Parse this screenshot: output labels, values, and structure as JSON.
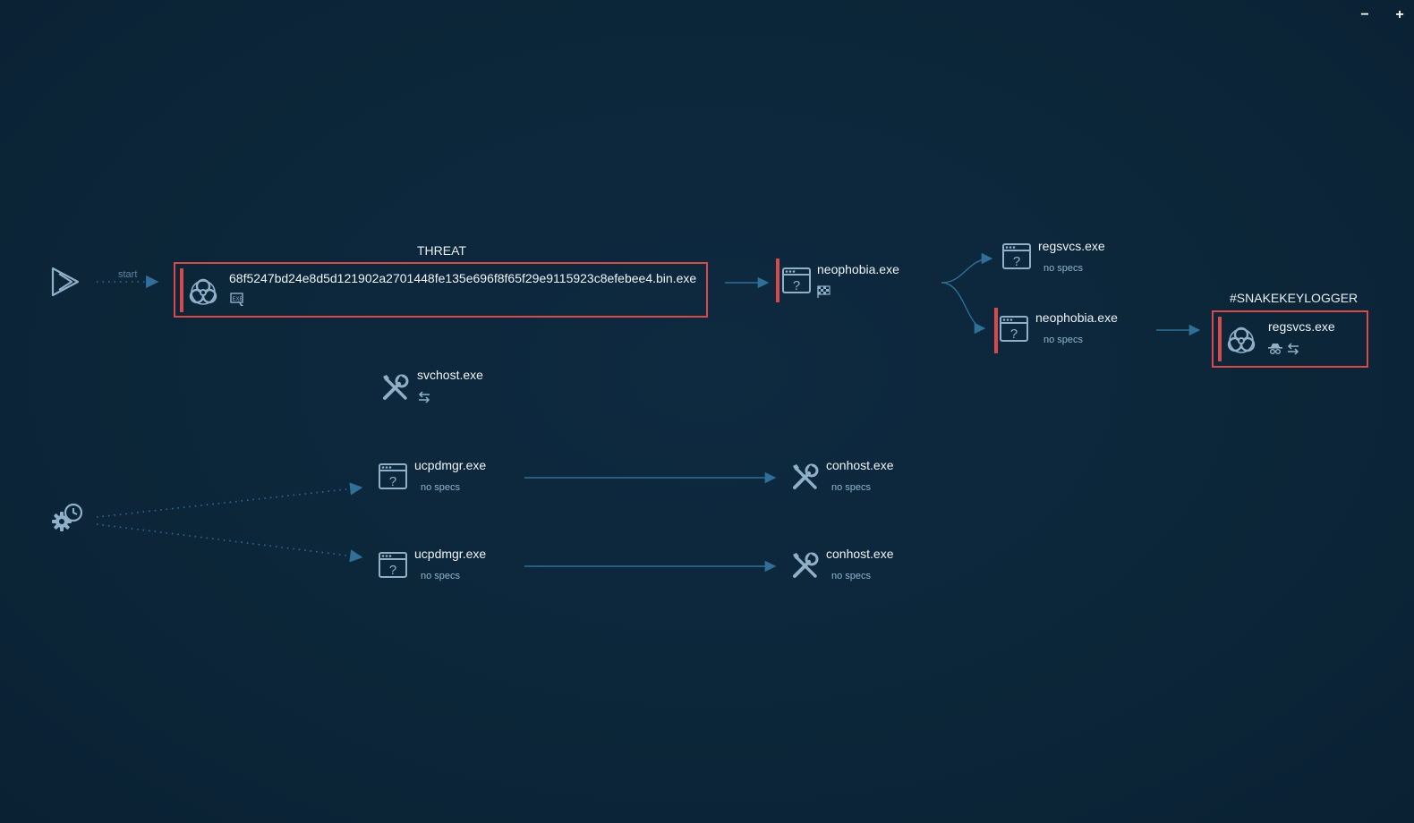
{
  "controls": {
    "zoom_out_label": "−",
    "zoom_in_label": "+"
  },
  "edges": {
    "start_label": "start"
  },
  "groups": {
    "threat": "THREAT",
    "snakekeylogger": "#SNAKEKEYLOGGER"
  },
  "nodes": {
    "main_threat": {
      "name": "68f5247bd24e8d5d121902a2701448fe135e696f8f65f29e9115923c8efebee4.bin.exe",
      "icon": "biohazard-icon",
      "badges": [
        "exe-icon"
      ]
    },
    "neophobia_1": {
      "name": "neophobia.exe",
      "icon": "unknown-window-icon",
      "badges": [
        "checkered-flag-icon"
      ]
    },
    "regsvcs_1": {
      "name": "regsvcs.exe",
      "sub": "no specs",
      "icon": "unknown-window-icon"
    },
    "neophobia_2": {
      "name": "neophobia.exe",
      "sub": "no specs",
      "icon": "unknown-window-icon"
    },
    "regsvcs_2": {
      "name": "regsvcs.exe",
      "icon": "biohazard-icon",
      "badges": [
        "spy-icon",
        "network-icon"
      ]
    },
    "svchost": {
      "name": "svchost.exe",
      "icon": "tools-icon",
      "badges": [
        "network-icon"
      ]
    },
    "ucpdmgr_1": {
      "name": "ucpdmgr.exe",
      "sub": "no specs",
      "icon": "unknown-window-icon"
    },
    "conhost_1": {
      "name": "conhost.exe",
      "sub": "no specs",
      "icon": "tools-icon"
    },
    "ucpdmgr_2": {
      "name": "ucpdmgr.exe",
      "sub": "no specs",
      "icon": "unknown-window-icon"
    },
    "conhost_2": {
      "name": "conhost.exe",
      "sub": "no specs",
      "icon": "tools-icon"
    }
  },
  "roots": {
    "start": {
      "icon": "play-icon"
    },
    "scheduled": {
      "icon": "scheduled-task-icon"
    }
  },
  "colors": {
    "background": "#0c2639",
    "edge": "#2f6f98",
    "threat_border": "#d9494a",
    "icon": "#8fb0c8",
    "text": "#eef3f7",
    "subtext": "#8fb5cf"
  }
}
